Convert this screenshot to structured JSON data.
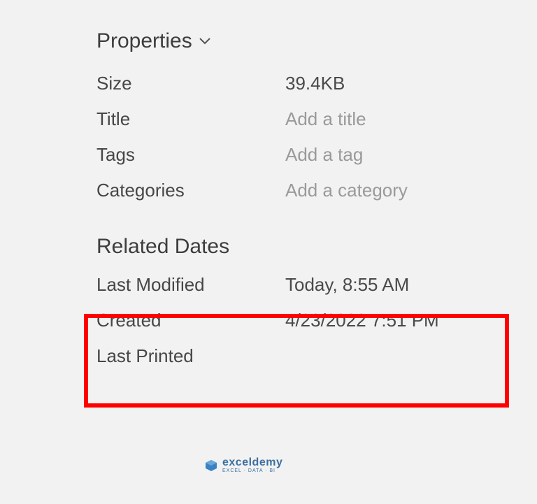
{
  "header": {
    "title": "Properties"
  },
  "properties": {
    "size": {
      "label": "Size",
      "value": "39.4KB"
    },
    "title": {
      "label": "Title",
      "placeholder": "Add a title"
    },
    "tags": {
      "label": "Tags",
      "placeholder": "Add a tag"
    },
    "categories": {
      "label": "Categories",
      "placeholder": "Add a category"
    }
  },
  "related_dates": {
    "heading": "Related Dates",
    "last_modified": {
      "label": "Last Modified",
      "value": "Today, 8:55 AM"
    },
    "created": {
      "label": "Created",
      "value": "4/23/2022 7:51 PM"
    },
    "last_printed": {
      "label": "Last Printed",
      "value": ""
    }
  },
  "watermark": {
    "brand": "exceldemy",
    "sub": "EXCEL · DATA · BI"
  }
}
